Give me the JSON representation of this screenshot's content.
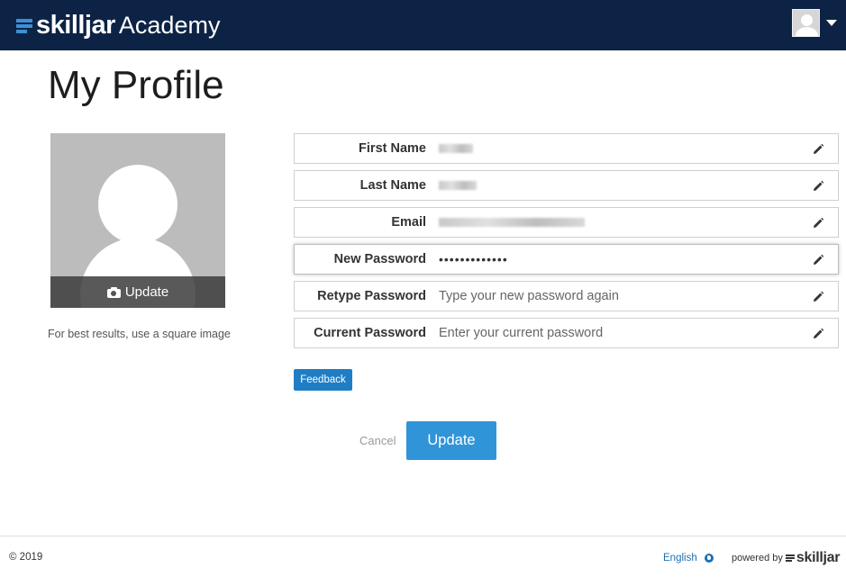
{
  "header": {
    "brand": "skilljar",
    "brand_suffix": "Academy",
    "bg_color": "#0d2345"
  },
  "page": {
    "title": "My Profile"
  },
  "profile_photo": {
    "update_label": "Update",
    "hint": "For best results, use a square image"
  },
  "form": {
    "fields": [
      {
        "label": "First Name",
        "value": "",
        "placeholder": ""
      },
      {
        "label": "Last Name",
        "value": "",
        "placeholder": ""
      },
      {
        "label": "Email",
        "value": "",
        "placeholder": ""
      },
      {
        "label": "New Password",
        "value": "•••••••••••••",
        "placeholder": ""
      },
      {
        "label": "Retype Password",
        "value": "",
        "placeholder": "Type your new password again"
      },
      {
        "label": "Current Password",
        "value": "",
        "placeholder": "Enter your current password"
      }
    ],
    "feedback_label": "Feedback",
    "cancel_label": "Cancel",
    "submit_label": "Update",
    "accent_color": "#2f95d8"
  },
  "footer": {
    "copyright": "© 2019",
    "language": "English",
    "powered_by": "powered by",
    "powered_brand": "skilljar"
  }
}
